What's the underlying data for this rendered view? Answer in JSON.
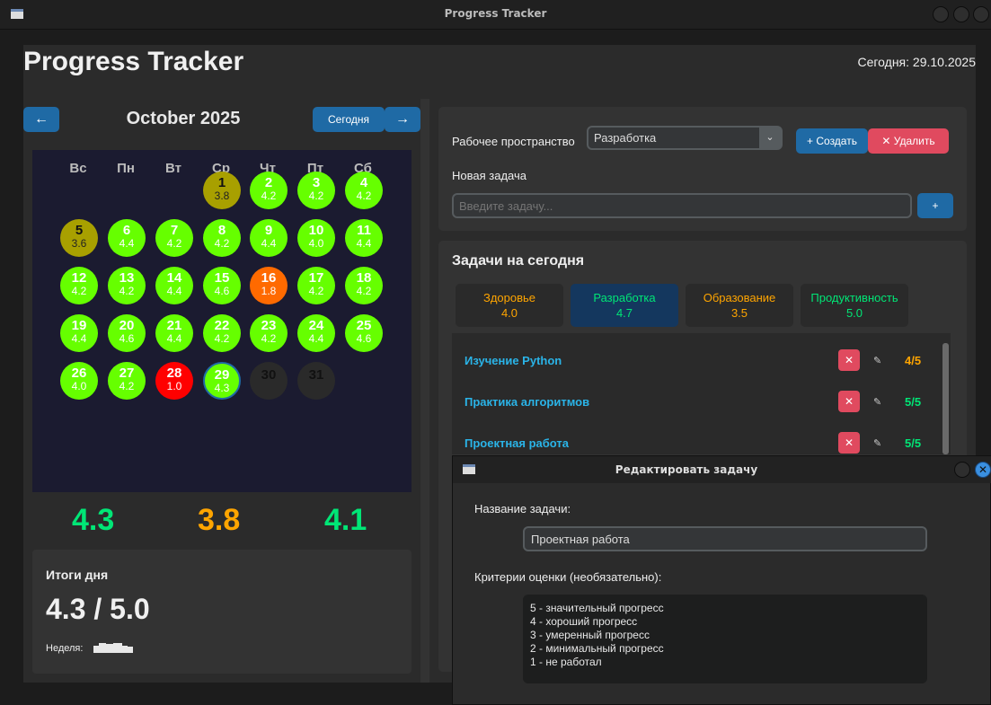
{
  "window": {
    "title": "Progress Tracker"
  },
  "header": {
    "app_title": "Progress Tracker",
    "today": "Сегодня: 29.10.2025"
  },
  "calendar": {
    "prev_label": "←",
    "month_label": "October 2025",
    "today_label": "Сегодня",
    "next_label": "→",
    "weekdays": [
      "Вс",
      "Пн",
      "Вт",
      "Ср",
      "Чт",
      "Пт",
      "Сб"
    ],
    "days": [
      {
        "n": "1",
        "s": "3.8"
      },
      {
        "n": "2",
        "s": "4.2"
      },
      {
        "n": "3",
        "s": "4.2"
      },
      {
        "n": "4",
        "s": "4.2"
      },
      {
        "n": "5",
        "s": "3.6"
      },
      {
        "n": "6",
        "s": "4.4"
      },
      {
        "n": "7",
        "s": "4.2"
      },
      {
        "n": "8",
        "s": "4.2"
      },
      {
        "n": "9",
        "s": "4.4"
      },
      {
        "n": "10",
        "s": "4.0"
      },
      {
        "n": "11",
        "s": "4.4"
      },
      {
        "n": "12",
        "s": "4.2"
      },
      {
        "n": "13",
        "s": "4.2"
      },
      {
        "n": "14",
        "s": "4.4"
      },
      {
        "n": "15",
        "s": "4.6"
      },
      {
        "n": "16",
        "s": "1.8"
      },
      {
        "n": "17",
        "s": "4.2"
      },
      {
        "n": "18",
        "s": "4.2"
      },
      {
        "n": "19",
        "s": "4.4"
      },
      {
        "n": "20",
        "s": "4.6"
      },
      {
        "n": "21",
        "s": "4.4"
      },
      {
        "n": "22",
        "s": "4.2"
      },
      {
        "n": "23",
        "s": "4.2"
      },
      {
        "n": "24",
        "s": "4.4"
      },
      {
        "n": "25",
        "s": "4.6"
      },
      {
        "n": "26",
        "s": "4.0"
      },
      {
        "n": "27",
        "s": "4.2"
      },
      {
        "n": "28",
        "s": "1.0"
      },
      {
        "n": "29",
        "s": "4.3"
      },
      {
        "n": "30",
        "s": ""
      },
      {
        "n": "31",
        "s": ""
      }
    ]
  },
  "stats": {
    "a": "4.3",
    "b": "3.8",
    "c": "4.1"
  },
  "summary": {
    "title": "Итоги дня",
    "value": "4.3 / 5.0",
    "week_label": "Неделя:"
  },
  "workspace": {
    "label": "Рабочее пространство",
    "selected": "Разработка",
    "create_label": "+ Создать",
    "delete_label": "✕ Удалить",
    "new_task_label": "Новая задача",
    "new_task_placeholder": "Введите задачу...",
    "add_label": "+"
  },
  "tasks": {
    "title": "Задачи на сегодня",
    "categories": [
      {
        "name": "Здоровье",
        "score": "4.0"
      },
      {
        "name": "Разработка",
        "score": "4.7"
      },
      {
        "name": "Образование",
        "score": "3.5"
      },
      {
        "name": "Продуктивность",
        "score": "5.0"
      }
    ],
    "items": [
      {
        "name": "Изучение Python",
        "score": "4/5"
      },
      {
        "name": "Практика алгоритмов",
        "score": "5/5"
      },
      {
        "name": "Проектная работа",
        "score": "5/5"
      }
    ],
    "delete_icon": "✕",
    "edit_icon": "✎"
  },
  "dialog": {
    "title": "Редактировать задачу",
    "name_label": "Название задачи:",
    "name_value": "Проектная работа",
    "criteria_label": "Критерии оценки (необязательно):",
    "criteria": [
      "5 - значительный прогресс",
      "4 - хороший прогресс",
      "3 - умеренный прогресс",
      "2 - минимальный прогресс",
      "1 - не работал"
    ]
  },
  "colors": {
    "accent": "#1f6aa5",
    "danger": "#e04a5f",
    "good": "#00e676",
    "medium": "#ffa500",
    "day_green": "#66ff00",
    "day_olive": "#a8a000",
    "day_orange": "#ff6a00",
    "day_red": "#ff0000"
  }
}
